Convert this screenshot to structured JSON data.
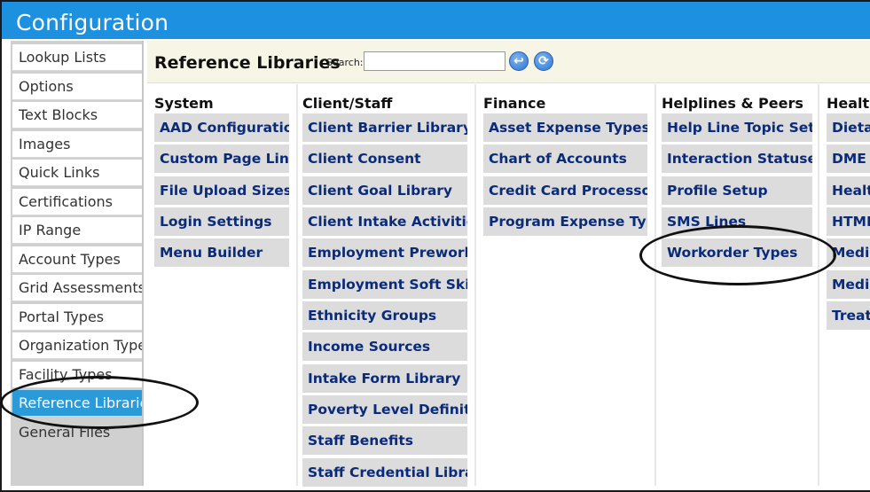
{
  "window": {
    "title": "Configuration"
  },
  "sidebar": {
    "items": [
      {
        "label": "Lookup Lists"
      },
      {
        "label": "Options"
      },
      {
        "label": "Text Blocks"
      },
      {
        "label": "Images"
      },
      {
        "label": "Quick Links"
      },
      {
        "label": "Certifications"
      },
      {
        "label": "IP Range"
      },
      {
        "label": "Account Types"
      },
      {
        "label": "Grid Assessments"
      },
      {
        "label": "Portal Types"
      },
      {
        "label": "Organization Types"
      },
      {
        "label": "Facility Types"
      },
      {
        "label": "Reference Libraries"
      },
      {
        "label": "General Files"
      }
    ],
    "active_index": 12
  },
  "header": {
    "title": "Reference Libraries",
    "search_label": "Search:",
    "search_value": "",
    "back_icon": "back-arrow-icon",
    "refresh_icon": "refresh-icon"
  },
  "columns": [
    {
      "title": "System",
      "items": [
        "AAD Configuration",
        "Custom Page Links",
        "File Upload Sizes",
        "Login Settings",
        "Menu Builder"
      ]
    },
    {
      "title": "Client/Staff",
      "items": [
        "Client Barrier Library",
        "Client Consent",
        "Client Goal Library",
        "Client Intake Activities",
        "Employment Prework",
        "Employment Soft Skills",
        "Ethnicity Groups",
        "Income Sources",
        "Intake Form Library",
        "Poverty Level Definition",
        "Staff Benefits",
        "Staff Credential Library"
      ]
    },
    {
      "title": "Finance",
      "items": [
        "Asset Expense Types",
        "Chart of Accounts",
        "Credit Card Processors",
        "Program Expense Types"
      ]
    },
    {
      "title": "Helplines & Peers",
      "items": [
        "Help Line Topic Setup",
        "Interaction Statuses",
        "Profile Setup",
        "SMS Lines",
        "Workorder Types"
      ]
    },
    {
      "title": "Healt",
      "items": [
        "Dieta",
        "DME",
        "Healt",
        "HTML",
        "Medic",
        "Medic",
        "Treat"
      ]
    }
  ],
  "colors": {
    "titlebar": "#1e90e0",
    "active_item": "#2b9ad8",
    "tile_bg": "#dcdcdc",
    "tile_text": "#0a2a7a",
    "header_bg": "#f7f6e6"
  }
}
